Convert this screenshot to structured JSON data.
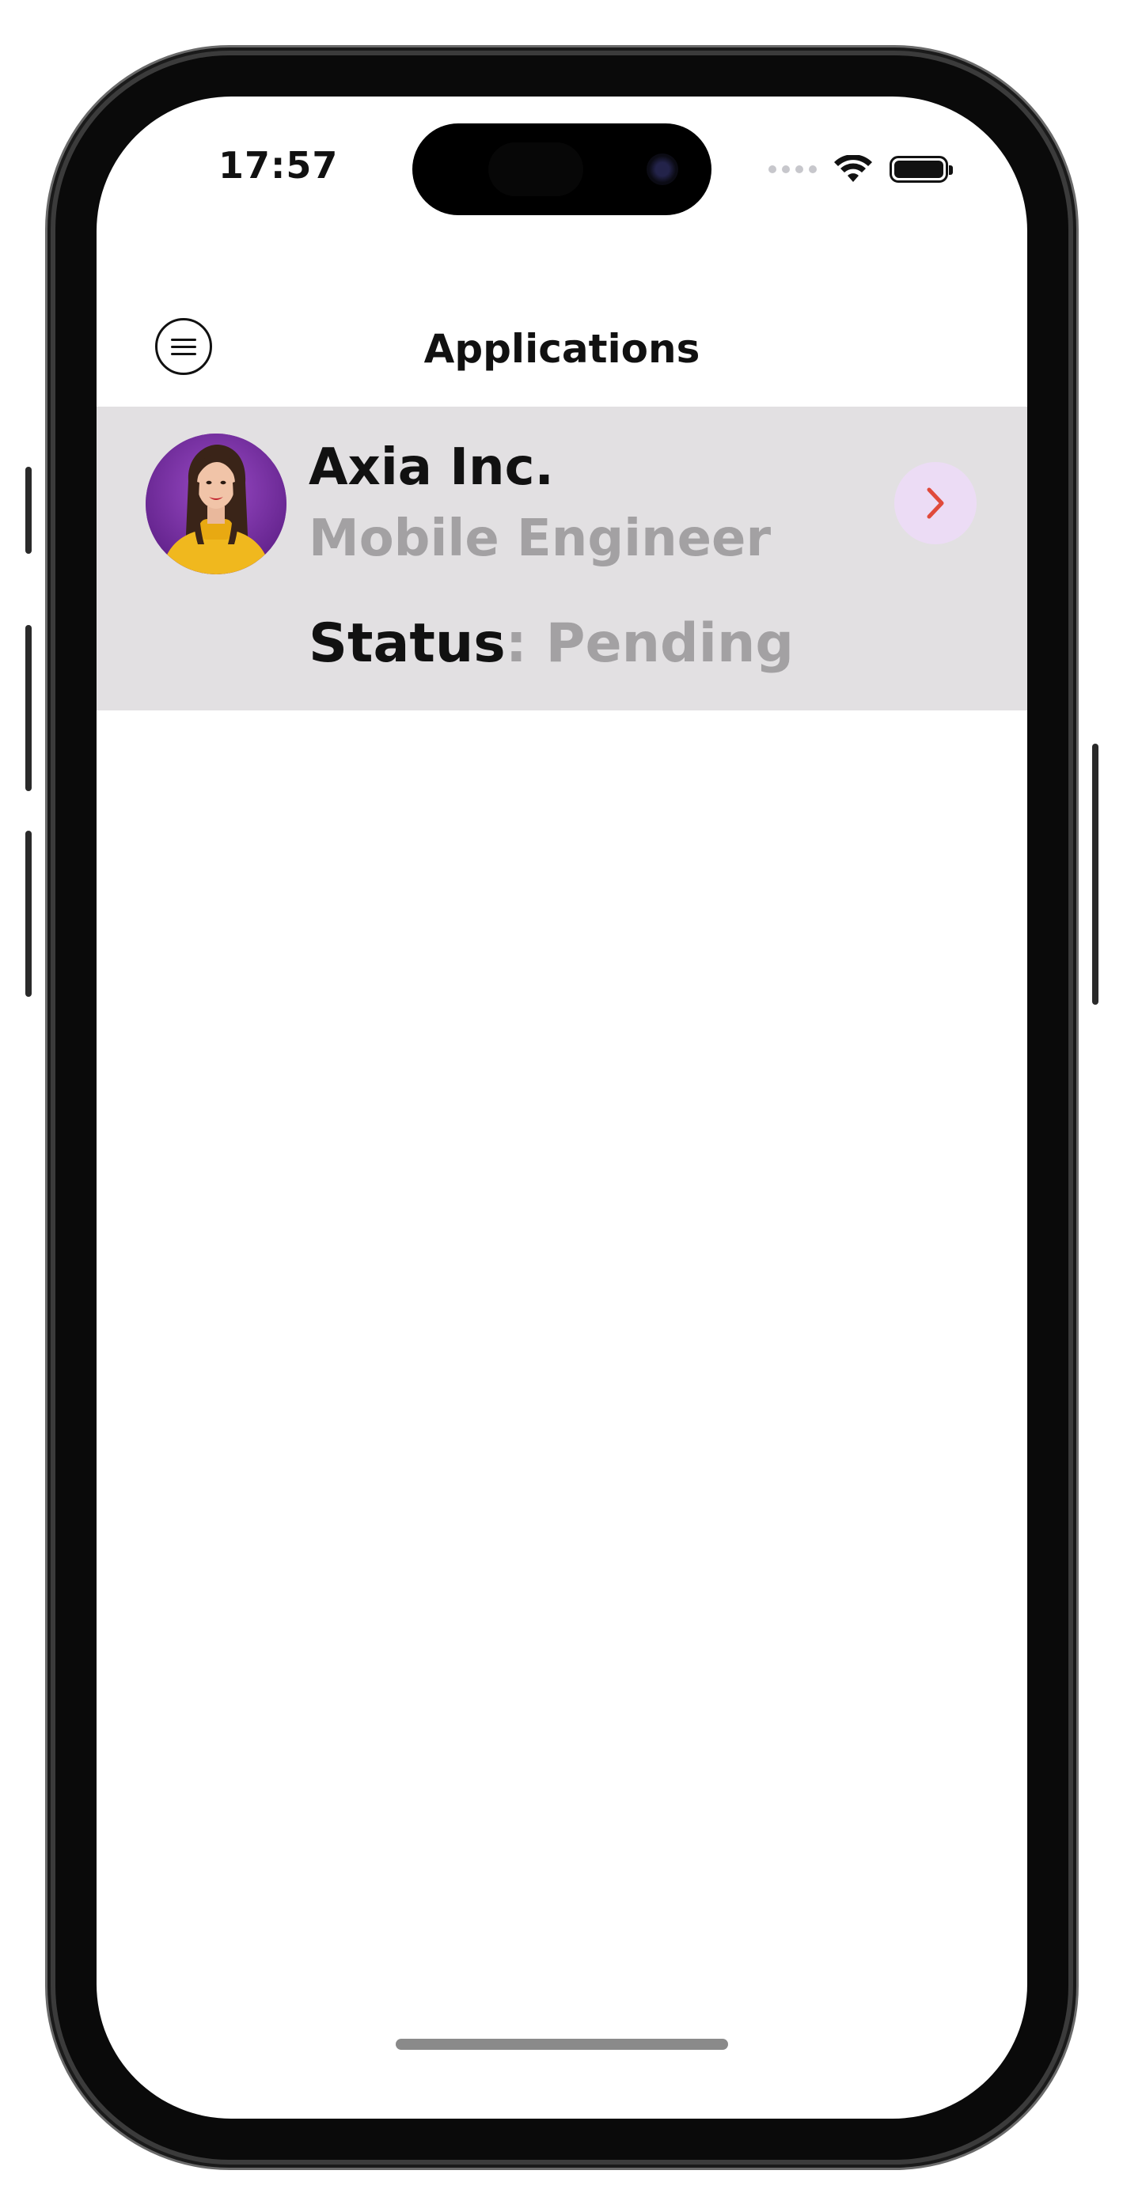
{
  "status_bar": {
    "time": "17:57",
    "icons": [
      "cellular-signal-icon",
      "wifi-icon",
      "battery-icon"
    ]
  },
  "header": {
    "title": "Applications",
    "menu_icon": "hamburger-menu-icon"
  },
  "applications": [
    {
      "company": "Axia Inc.",
      "position": "Mobile Engineer",
      "status_label": "Status",
      "status_value": ": Pending",
      "avatar_icon": "person-avatar",
      "action_icon": "chevron-right-icon"
    }
  ],
  "colors": {
    "row_background": "#e2e0e2",
    "secondary_text": "#a3a1a3",
    "chevron_accent": "#e04a3b",
    "chevron_bg": "#ecdcf5",
    "avatar_bg": "#7a2fa5"
  }
}
